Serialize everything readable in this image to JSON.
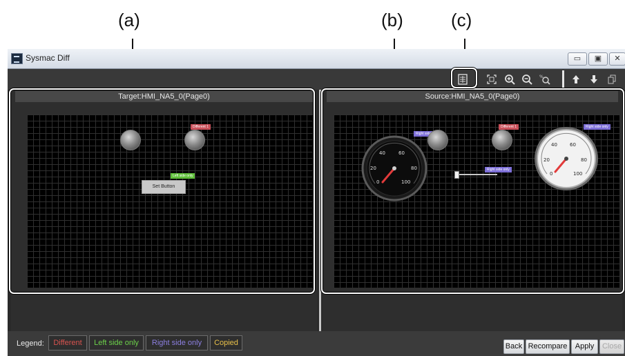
{
  "annotations": {
    "a": "(a)",
    "b": "(b)",
    "c": "(c)"
  },
  "window": {
    "title": "Sysmac Diff"
  },
  "window_controls": {
    "minimize": "▭",
    "maximize": "▣",
    "close": "✕"
  },
  "toolbar": {
    "icons": [
      "toggle-display-icon",
      "fit-window-icon",
      "zoom-in-icon",
      "zoom-out-icon",
      "zoom-100-icon",
      "previous-difference-icon",
      "next-difference-icon",
      "copy-icon"
    ]
  },
  "target_pane": {
    "header": "Target:HMI_NA5_0(Page0)",
    "tags": {
      "different": "Different 1",
      "left_only": "Left side only"
    },
    "set_button": "Set Button"
  },
  "source_pane": {
    "header": "Source:HMI_NA5_0(Page0)",
    "tags": {
      "different": "Different 1",
      "right_only_1": "Right side only",
      "right_only_2": "Right side only",
      "right_only_3": "Right side only"
    },
    "gauge_dark": {
      "ticks": [
        "0",
        "20",
        "40",
        "60",
        "80",
        "100"
      ]
    },
    "gauge_light": {
      "ticks": [
        "0",
        "20",
        "40",
        "60",
        "80",
        "100"
      ]
    }
  },
  "legend": {
    "label": "Legend:",
    "different": "Different",
    "left_only": "Left side only",
    "right_only": "Right side only",
    "copied": "Copied"
  },
  "buttons": {
    "back": "Back",
    "recompare": "Recompare",
    "apply": "Apply",
    "close": "Close"
  },
  "colors": {
    "different": "#d9534f",
    "left_only": "#6cd04a",
    "right_only": "#8c7fe0",
    "copied": "#e8c04a",
    "tag_different_bg": "#c9505a",
    "tag_left_bg": "#5fbf3a",
    "tag_right_bg": "#7d6fd8"
  }
}
